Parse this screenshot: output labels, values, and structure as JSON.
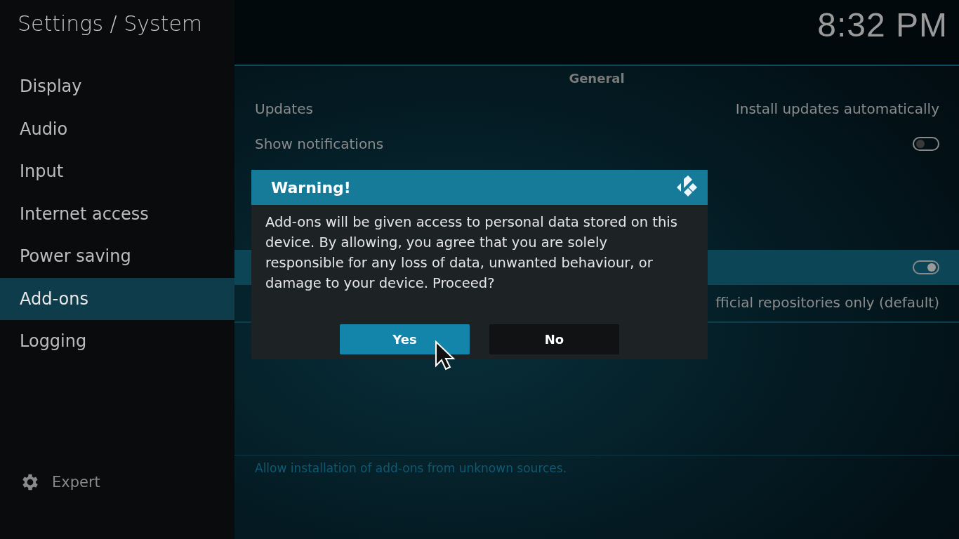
{
  "header": {
    "title": "Settings / System",
    "clock": "8:32 PM"
  },
  "sidebar": {
    "items": [
      {
        "label": "Display",
        "selected": false
      },
      {
        "label": "Audio",
        "selected": false
      },
      {
        "label": "Input",
        "selected": false
      },
      {
        "label": "Internet access",
        "selected": false
      },
      {
        "label": "Power saving",
        "selected": false
      },
      {
        "label": "Add-ons",
        "selected": true
      },
      {
        "label": "Logging",
        "selected": false
      }
    ],
    "level_button": "Expert"
  },
  "section": "General",
  "settings": [
    {
      "kind": "value",
      "label": "Updates",
      "value": "Install updates automatically",
      "selected": false
    },
    {
      "kind": "toggle",
      "label": "Show notifications",
      "on": false,
      "selected": false
    },
    {
      "kind": "toggle",
      "on": true,
      "selected": true
    },
    {
      "kind": "value",
      "value": "fficial repositories only (default)",
      "selected": false
    }
  ],
  "description": "Allow installation of add-ons from unknown sources.",
  "dialog": {
    "title": "Warning!",
    "message": "Add-ons will be given access to personal data stored on this device. By allowing, you agree that you are solely responsible for any loss of data, unwanted behaviour, or damage to your device. Proceed?",
    "buttons": [
      {
        "label": "Yes",
        "selected": true
      },
      {
        "label": "No",
        "selected": false
      }
    ]
  }
}
